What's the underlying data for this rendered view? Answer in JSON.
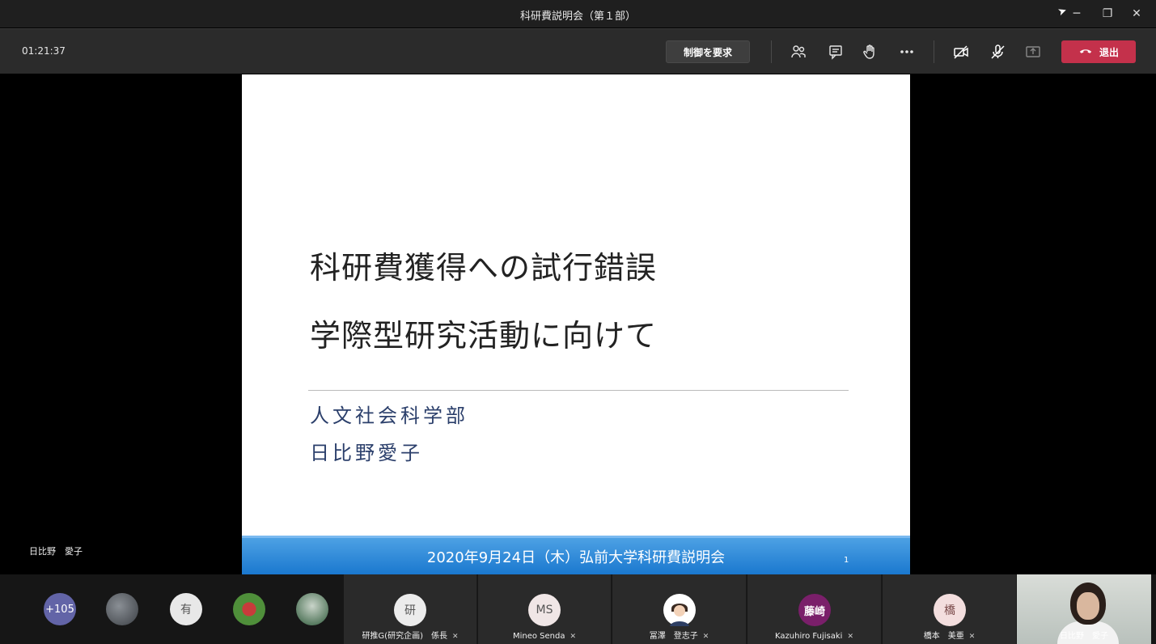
{
  "window": {
    "title": "科研費説明会（第１部）"
  },
  "toolbar": {
    "elapsed_time": "01:21:37",
    "request_control_label": "制御を要求",
    "leave_label": "退出"
  },
  "slide": {
    "title": "科研費獲得への試行錯誤",
    "subtitle": "学際型研究活動に向けて",
    "department": "人文社会科学部",
    "author": "日比野愛子",
    "footer": "2020年9月24日（木）弘前大学科研費説明会",
    "page_number": "1"
  },
  "presenter_label": "日比野　愛子",
  "participants": {
    "overflow_count": "+105",
    "avatars": [
      {
        "initial": "有",
        "color": "#e8e8e8"
      },
      {
        "initial": "研",
        "name": "研推G(研究企画)　係長",
        "color": "#ececec"
      },
      {
        "initial": "MS",
        "name": "Mineo Senda",
        "color": "#f0e6e6"
      },
      {
        "initial": "",
        "name": "冨澤　登志子",
        "color": "#ffffff"
      },
      {
        "initial": "藤崎",
        "name": "Kazuhiro Fujisaki",
        "color": "#7a1f6a"
      },
      {
        "initial": "橋",
        "name": "橋本　美亜",
        "color": "#f3dede"
      }
    ],
    "self_name": "日比野　愛子"
  }
}
